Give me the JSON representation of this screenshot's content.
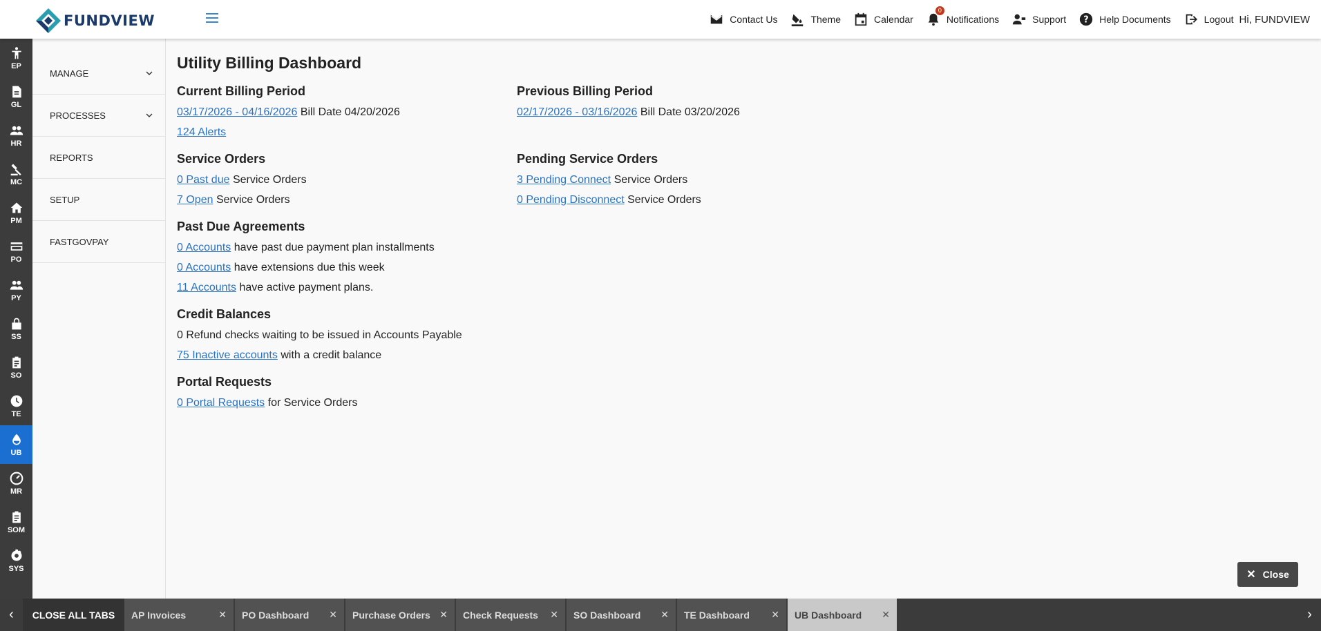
{
  "app": {
    "brand": "FUNDVIEW"
  },
  "header": {
    "nav": [
      {
        "label": "Contact Us",
        "icon": "mail-icon"
      },
      {
        "label": "Theme",
        "icon": "paint-bucket-icon"
      },
      {
        "label": "Calendar",
        "icon": "calendar-icon"
      },
      {
        "label": "Notifications",
        "icon": "bell-icon",
        "badge": "0"
      },
      {
        "label": "Support",
        "icon": "support-icon"
      },
      {
        "label": "Help Documents",
        "icon": "help-icon"
      },
      {
        "label": "Logout",
        "icon": "logout-icon"
      }
    ],
    "greeting": "Hi, FUNDVIEW"
  },
  "rail": [
    {
      "label": "EP",
      "icon": "person-icon"
    },
    {
      "label": "GL",
      "icon": "document-icon"
    },
    {
      "label": "HR",
      "icon": "people-icon"
    },
    {
      "label": "MC",
      "icon": "gavel-icon"
    },
    {
      "label": "PM",
      "icon": "home-icon"
    },
    {
      "label": "PO",
      "icon": "card-icon"
    },
    {
      "label": "PY",
      "icon": "people-icon"
    },
    {
      "label": "SS",
      "icon": "lock-icon"
    },
    {
      "label": "SO",
      "icon": "clipboard-icon"
    },
    {
      "label": "TE",
      "icon": "clock-icon"
    },
    {
      "label": "UB",
      "icon": "water-drop-icon",
      "active": true
    },
    {
      "label": "MR",
      "icon": "meter-icon"
    },
    {
      "label": "SOM",
      "icon": "clipboard-icon"
    },
    {
      "label": "SYS",
      "icon": "gear-icon"
    }
  ],
  "sidebar": {
    "items": [
      {
        "label": "MANAGE",
        "expandable": true
      },
      {
        "label": "PROCESSES",
        "expandable": true
      },
      {
        "label": "REPORTS"
      },
      {
        "label": "SETUP"
      },
      {
        "label": "FASTGOVPAY"
      }
    ]
  },
  "dashboard": {
    "title": "Utility Billing Dashboard",
    "current_billing": {
      "title": "Current Billing Period",
      "period_link": "03/17/2026 - 04/16/2026",
      "bill_date": "Bill Date 04/20/2026",
      "alerts_link": "124 Alerts"
    },
    "previous_billing": {
      "title": "Previous Billing Period",
      "period_link": "02/17/2026 - 03/16/2026",
      "bill_date": "Bill Date 03/20/2026"
    },
    "service_orders": {
      "title": "Service Orders",
      "past_due_link": "0 Past due",
      "past_due_text": "Service Orders",
      "open_link": "7 Open",
      "open_text": "Service Orders"
    },
    "pending_service_orders": {
      "title": "Pending Service Orders",
      "connect_link": "3 Pending Connect",
      "connect_text": "Service Orders",
      "disconnect_link": "0 Pending Disconnect",
      "disconnect_text": "Service Orders"
    },
    "past_due_agreements": {
      "title": "Past Due Agreements",
      "rows": [
        {
          "link": "0 Accounts",
          "text": "have past due payment plan installments"
        },
        {
          "link": "0 Accounts",
          "text": "have extensions due this week"
        },
        {
          "link": "11 Accounts",
          "text": "have active payment plans."
        }
      ]
    },
    "credit_balances": {
      "title": "Credit Balances",
      "refund_text": "0 Refund checks waiting to be issued in Accounts Payable",
      "inactive_link": "75 Inactive accounts",
      "inactive_text": "with a credit balance"
    },
    "portal_requests": {
      "title": "Portal Requests",
      "link": "0 Portal Requests",
      "text": "for Service Orders"
    }
  },
  "close_button": {
    "label": "Close"
  },
  "tabbar": {
    "close_all": "CLOSE ALL TABS",
    "tabs": [
      {
        "label": "AP Invoices"
      },
      {
        "label": "PO Dashboard"
      },
      {
        "label": "Purchase Orders"
      },
      {
        "label": "Check Requests"
      },
      {
        "label": "SO Dashboard"
      },
      {
        "label": "TE Dashboard"
      },
      {
        "label": "UB Dashboard",
        "active": true
      }
    ]
  },
  "colors": {
    "accent": "#1b6fd1",
    "link": "#2a73c2",
    "rail_bg": "#3c3c3c",
    "badge": "#c0391b"
  }
}
